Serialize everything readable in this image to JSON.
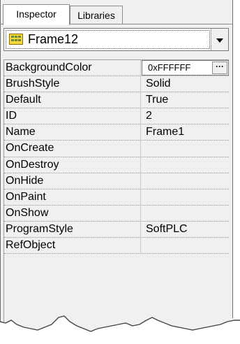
{
  "tabs": [
    {
      "label": "Inspector",
      "active": true
    },
    {
      "label": "Libraries",
      "active": false
    }
  ],
  "selector": {
    "icon": "frame-icon",
    "value": "Frame12"
  },
  "properties": [
    {
      "name": "BackgroundColor",
      "value": "0xFFFFFF"
    },
    {
      "name": "BrushStyle",
      "value": "Solid"
    },
    {
      "name": "Default",
      "value": "True"
    },
    {
      "name": "ID",
      "value": "2"
    },
    {
      "name": "Name",
      "value": "Frame1"
    },
    {
      "name": "OnCreate",
      "value": ""
    },
    {
      "name": "OnDestroy",
      "value": ""
    },
    {
      "name": "OnHide",
      "value": ""
    },
    {
      "name": "OnPaint",
      "value": ""
    },
    {
      "name": "OnShow",
      "value": ""
    },
    {
      "name": "ProgramStyle",
      "value": "SoftPLC"
    },
    {
      "name": "RefObject",
      "value": ""
    }
  ],
  "ellipsis_label": "···"
}
